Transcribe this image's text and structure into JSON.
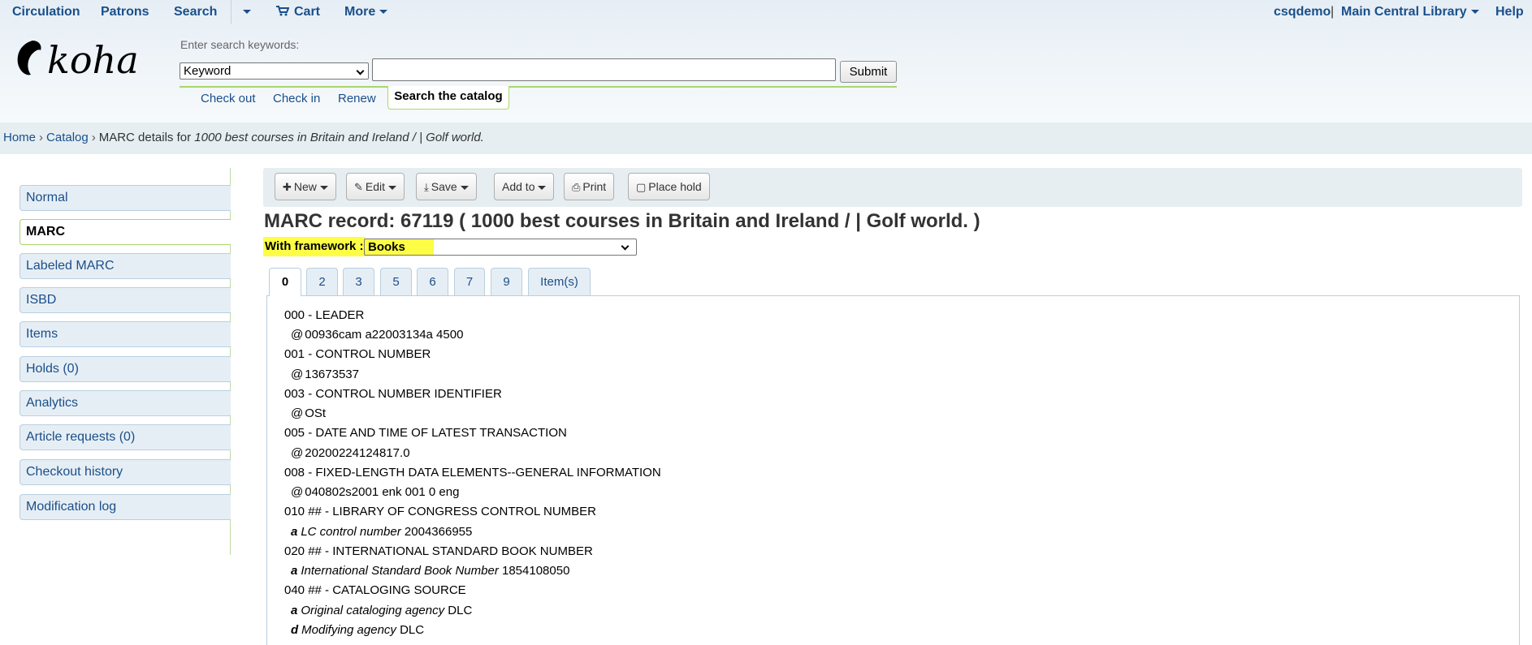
{
  "nav": {
    "circulation": "Circulation",
    "patrons": "Patrons",
    "search": "Search",
    "cart": "Cart",
    "more": "More",
    "user": "csqdemo",
    "divider": "|",
    "library": "Main Central Library",
    "help": "Help"
  },
  "logo": {
    "text": "koha"
  },
  "search": {
    "label": "Enter search keywords:",
    "type_selected": "Keyword",
    "value": "",
    "submit_label": "Submit",
    "tools": [
      "Check out",
      "Check in",
      "Renew"
    ],
    "catalog_tab": "Search the catalog"
  },
  "breadcrumb": {
    "home": "Home",
    "catalog": "Catalog",
    "current_prefix": "MARC details for",
    "current_title": "1000 best courses in Britain and Ireland / | Golf world."
  },
  "sidebar": {
    "items": [
      {
        "label": "Normal",
        "active": false
      },
      {
        "label": "MARC",
        "active": true
      },
      {
        "label": "Labeled MARC",
        "active": false
      },
      {
        "label": "ISBD",
        "active": false
      },
      {
        "label": "Items",
        "active": false
      },
      {
        "label": "Holds (0)",
        "active": false
      },
      {
        "label": "Analytics",
        "active": false
      },
      {
        "label": "Article requests (0)",
        "active": false
      },
      {
        "label": "Checkout history",
        "active": false
      },
      {
        "label": "Modification log",
        "active": false
      }
    ]
  },
  "toolbar": {
    "new": "New",
    "edit": "Edit",
    "save": "Save",
    "add_to": "Add to",
    "print": "Print",
    "place_hold": "Place hold"
  },
  "record": {
    "title": "MARC record: 67119 ( 1000 best courses in Britain and Ireland / | Golf world. )",
    "framework_label": "With framework :",
    "framework_value": "Books"
  },
  "tabs": [
    "0",
    "2",
    "3",
    "5",
    "6",
    "7",
    "9",
    "Item(s)"
  ],
  "active_tab": "0",
  "marc": {
    "f000": {
      "tag": "000 - LEADER",
      "sub": "@",
      "value": "00936cam a22003134a 4500"
    },
    "f001": {
      "tag": "001 - CONTROL NUMBER",
      "sub": "@",
      "value": "13673537"
    },
    "f003": {
      "tag": "003 - CONTROL NUMBER IDENTIFIER",
      "sub": "@",
      "value": "OSt"
    },
    "f005": {
      "tag": "005 - DATE AND TIME OF LATEST TRANSACTION",
      "sub": "@",
      "value": "20200224124817.0"
    },
    "f008": {
      "tag": "008 - FIXED-LENGTH DATA ELEMENTS--GENERAL INFORMATION",
      "sub": "@",
      "value": "040802s2001 enk 001 0 eng"
    },
    "f010": {
      "tag": "010 ## - LIBRARY OF CONGRESS CONTROL NUMBER",
      "code": "a",
      "desc": "LC control number",
      "value": "2004366955"
    },
    "f020": {
      "tag": "020 ## - INTERNATIONAL STANDARD BOOK NUMBER",
      "code": "a",
      "desc": "International Standard Book Number",
      "value": "1854108050"
    },
    "f040": {
      "tag": "040 ## - CATALOGING SOURCE",
      "a_code": "a",
      "a_desc": "Original cataloging agency",
      "a_value": "DLC",
      "d_code": "d",
      "d_desc": "Modifying agency",
      "d_value": "DLC"
    }
  },
  "colors": {
    "link": "#1a4f8a",
    "highlight": "#fdfd45",
    "accent_green": "#a9d76e",
    "header_bg": "#e6eef5"
  }
}
